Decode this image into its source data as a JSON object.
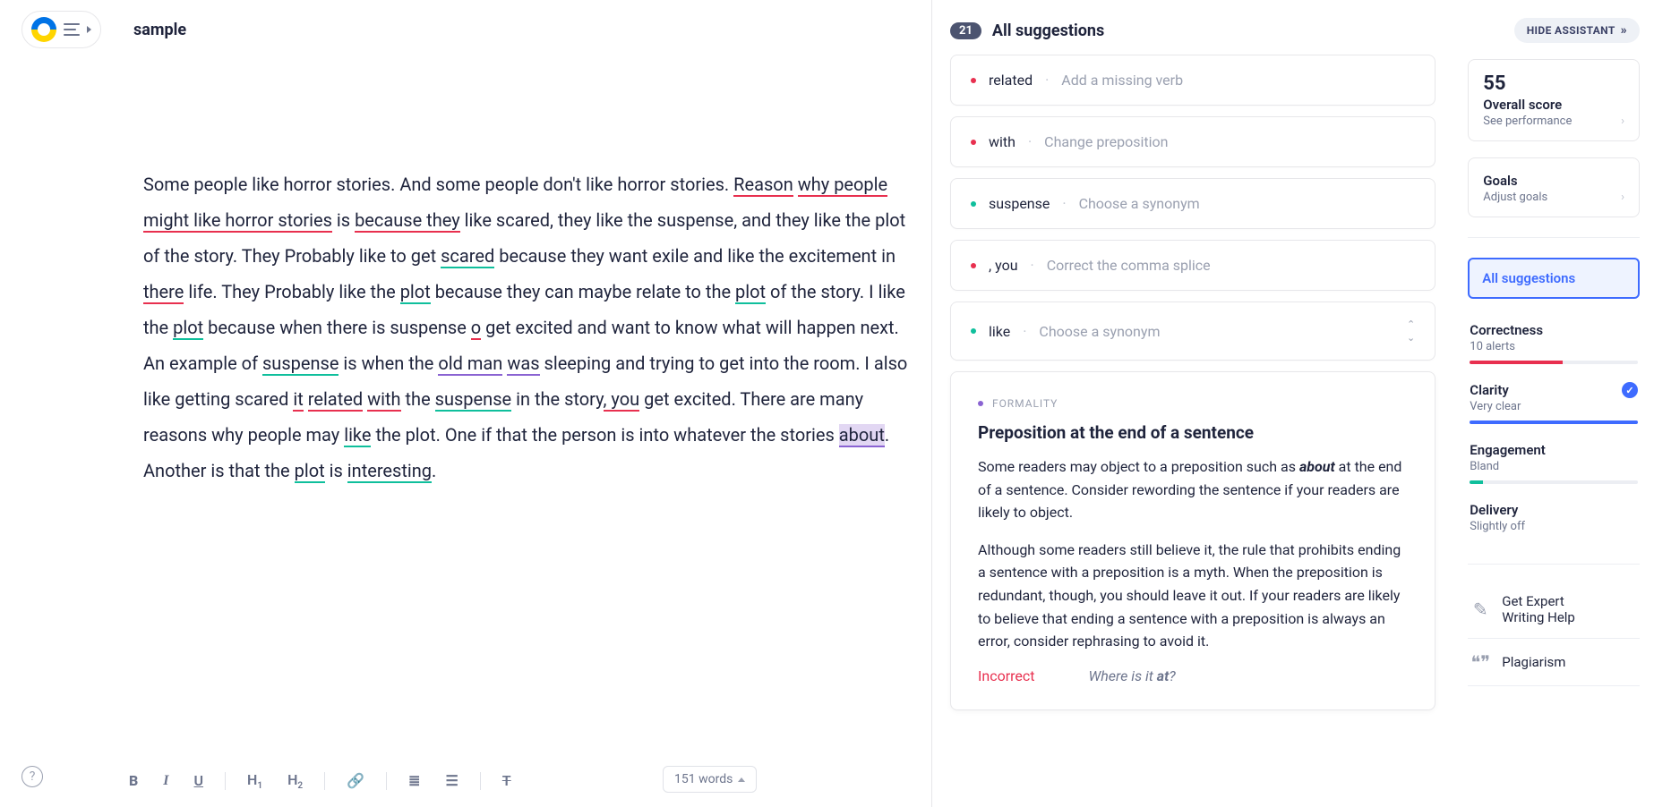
{
  "header": {
    "doc_title": "sample"
  },
  "editor": {
    "text_parts": [
      {
        "t": "Some people like horror stories. And some people don't like horror stories. "
      },
      {
        "t": "Reason",
        "cls": "u-red"
      },
      {
        "t": " "
      },
      {
        "t": "why people might like horror stories",
        "cls": "u-red"
      },
      {
        "t": " is "
      },
      {
        "t": "because they",
        "cls": "u-red"
      },
      {
        "t": " like scared, they like the suspense, and they like the plot of the story. They Probably like to get "
      },
      {
        "t": "scared",
        "cls": "u-teal"
      },
      {
        "t": " because they want exile and like the excitement in "
      },
      {
        "t": "there",
        "cls": "u-red"
      },
      {
        "t": " life. They Probably like the "
      },
      {
        "t": "plot",
        "cls": "u-teal"
      },
      {
        "t": " because they can maybe relate to the "
      },
      {
        "t": "plot",
        "cls": "u-teal"
      },
      {
        "t": " of the story. I like the "
      },
      {
        "t": "plot",
        "cls": "u-teal"
      },
      {
        "t": " because when there is suspense "
      },
      {
        "t": "o",
        "cls": "u-red"
      },
      {
        "t": " get excited and want to know what will happen next. An example of "
      },
      {
        "t": "suspense",
        "cls": "u-teal"
      },
      {
        "t": " is when the "
      },
      {
        "t": "old man",
        "cls": "u-purple"
      },
      {
        "t": " "
      },
      {
        "t": "was",
        "cls": "u-purple"
      },
      {
        "t": " sleeping and trying to get into the room. I also like getting scared "
      },
      {
        "t": "it",
        "cls": "u-red"
      },
      {
        "t": " "
      },
      {
        "t": "related",
        "cls": "u-red"
      },
      {
        "t": " "
      },
      {
        "t": "with",
        "cls": "u-red"
      },
      {
        "t": " the "
      },
      {
        "t": "suspense",
        "cls": "u-teal"
      },
      {
        "t": " in the story"
      },
      {
        "t": ", you",
        "cls": "u-red"
      },
      {
        "t": " get excited. There are many reasons why people may "
      },
      {
        "t": "like",
        "cls": "u-teal"
      },
      {
        "t": " the plot. One if that the person is into whatever the stories "
      },
      {
        "t": "a",
        "cursor": true
      },
      {
        "t": "bout",
        "cls": "hl u-purple"
      },
      {
        "t": ". Another is that the "
      },
      {
        "t": "plot",
        "cls": "u-teal"
      },
      {
        "t": " is "
      },
      {
        "t": "interesting",
        "cls": "u-teal"
      },
      {
        "t": "."
      }
    ],
    "word_count_label": "151 words"
  },
  "suggestions": {
    "count": "21",
    "heading": "All suggestions",
    "items": [
      {
        "color": "red",
        "word": "related",
        "hint": "Add a missing verb"
      },
      {
        "color": "red",
        "word": "with",
        "hint": "Change preposition"
      },
      {
        "color": "teal",
        "word": "suspense",
        "hint": "Choose a synonym"
      },
      {
        "color": "red",
        "word": ", you",
        "hint": "Correct the comma splice"
      },
      {
        "color": "teal",
        "word": "like",
        "hint": "Choose a synonym",
        "nav": true
      }
    ],
    "detail": {
      "category": "FORMALITY",
      "title": "Preposition at the end of a sentence",
      "para1_a": "Some readers may object to a preposition such as ",
      "para1_bold": "about",
      "para1_b": " at the end of a sentence. Consider rewording the sentence if your readers are likely to object.",
      "para2": "Although some readers still believe it, the rule that prohibits ending a sentence with a preposition is a myth. When the preposition is redundant, though, you should leave it out. If your readers are likely to believe that ending a sentence with a preposition is always an error, consider rephrasing to avoid it.",
      "example_label": "Incorrect",
      "example_a": "Where is it ",
      "example_bold": "at",
      "example_b": "?"
    }
  },
  "right": {
    "hide_label": "HIDE ASSISTANT",
    "score": {
      "value": "55",
      "title": "Overall score",
      "sub": "See performance"
    },
    "goals": {
      "title": "Goals",
      "sub": "Adjust goals"
    },
    "all_label": "All suggestions",
    "metrics": [
      {
        "name": "Correctness",
        "sub": "10 alerts",
        "color": "red",
        "w": "55%"
      },
      {
        "name": "Clarity",
        "sub": "Very clear",
        "color": "blue",
        "w": "100%",
        "check": true
      },
      {
        "name": "Engagement",
        "sub": "Bland",
        "color": "teal",
        "w": "8%"
      },
      {
        "name": "Delivery",
        "sub": "Slightly off",
        "color": "purple",
        "w": "0%",
        "nobar": true
      }
    ],
    "links": [
      {
        "icon": "✎",
        "label_a": "Get Expert",
        "label_b": "Writing Help"
      },
      {
        "icon": "❝❞",
        "label_a": "Plagiarism",
        "label_b": ""
      }
    ]
  },
  "toolbar": {
    "items": [
      "B",
      "I",
      "U",
      "H1",
      "H2",
      "link",
      "ol",
      "ul",
      "clear"
    ]
  }
}
